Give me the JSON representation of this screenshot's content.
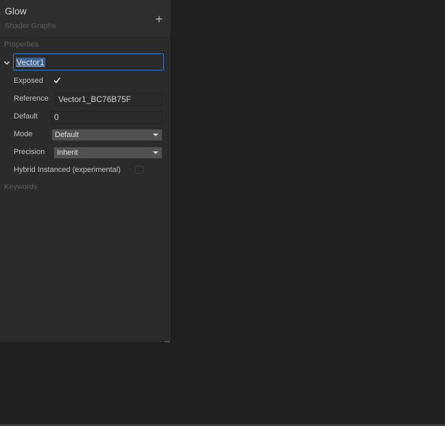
{
  "blackboard": {
    "title": "Glow",
    "subtitle": "Shader Graphs",
    "add_icon": "plus-icon",
    "add_label": "+",
    "sections": {
      "properties_label": "Properties",
      "keywords_label": "Keywords"
    },
    "property": {
      "name": "Vector1",
      "expand_icon": "chevron-down-icon",
      "exposed_label": "Exposed",
      "exposed_checked": true,
      "reference_label": "Reference",
      "reference_value": "Vector1_BC76B75F",
      "default_label": "Default",
      "default_value": "0",
      "mode_label": "Mode",
      "mode_value": "Default",
      "precision_label": "Precision",
      "precision_value": "Inherit",
      "hybrid_label": "Hybrid Instanced (experimental)",
      "hybrid_checked": false
    }
  },
  "colors": {
    "background": "#202020",
    "panel": "#2b2b2b",
    "focus_border": "#3e7bc2",
    "selection": "#3b5f8f"
  }
}
